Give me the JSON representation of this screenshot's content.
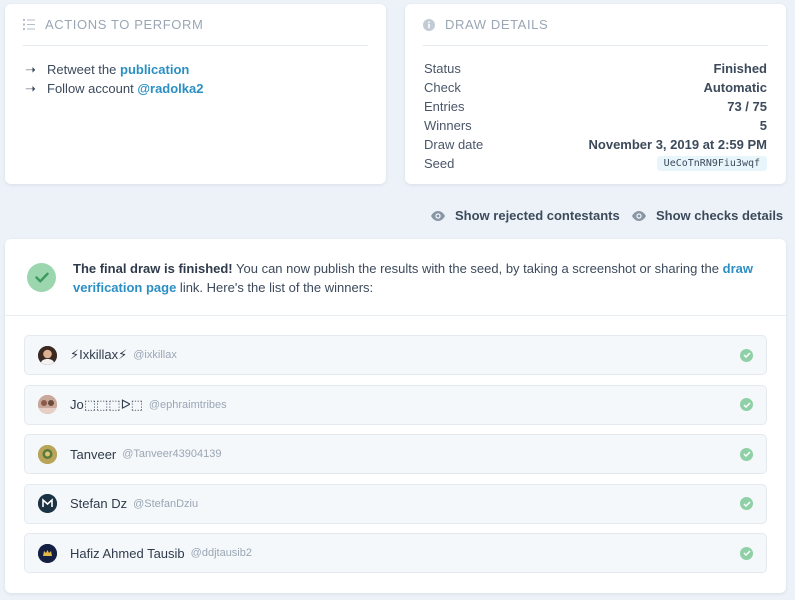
{
  "actions": {
    "title": "Actions to perform",
    "items": [
      {
        "prefix": "Retweet the ",
        "link": "publication"
      },
      {
        "prefix": "Follow account ",
        "link": "@radolka2"
      }
    ]
  },
  "details": {
    "title": "Draw details",
    "rows": [
      {
        "label": "Status",
        "value": "Finished"
      },
      {
        "label": "Check",
        "value": "Automatic"
      },
      {
        "label": "Entries",
        "value": "73 / 75"
      },
      {
        "label": "Winners",
        "value": "5"
      },
      {
        "label": "Draw date",
        "value": "November 3, 2019 at 2:59 PM"
      }
    ],
    "seed_label": "Seed",
    "seed_value": "UeCoTnRN9Fiu3wqf"
  },
  "toggles": {
    "rejected": "Show rejected contestants",
    "checks": "Show checks details"
  },
  "result": {
    "headline": "The final draw is finished!",
    "text_before_link": " You can now publish the results with the seed, by taking a screenshot or sharing the ",
    "link": "draw verification page",
    "text_after_link": " link. Here's the list of the winners:"
  },
  "winners": [
    {
      "name": "⚡Ixkillax⚡",
      "handle": "@ixkillax",
      "avatar_color": "#6b4a3a"
    },
    {
      "name": "Jo⬚⬚⬚ᐅ⬚",
      "handle": "@ephraimtribes",
      "avatar_color": "#b38a7a"
    },
    {
      "name": "Tanveer",
      "handle": "@Tanveer43904139",
      "avatar_color": "#8a7a3a"
    },
    {
      "name": "Stefan Dz",
      "handle": "@StefanDziu",
      "avatar_color": "#1f3a4c"
    },
    {
      "name": "Hafiz Ahmed Tausib",
      "handle": "@ddjtausib2",
      "avatar_color": "#1a2a5a"
    }
  ],
  "colors": {
    "accent": "#2b8fc4",
    "success": "#8fd0a6",
    "background": "#edf2f8"
  }
}
